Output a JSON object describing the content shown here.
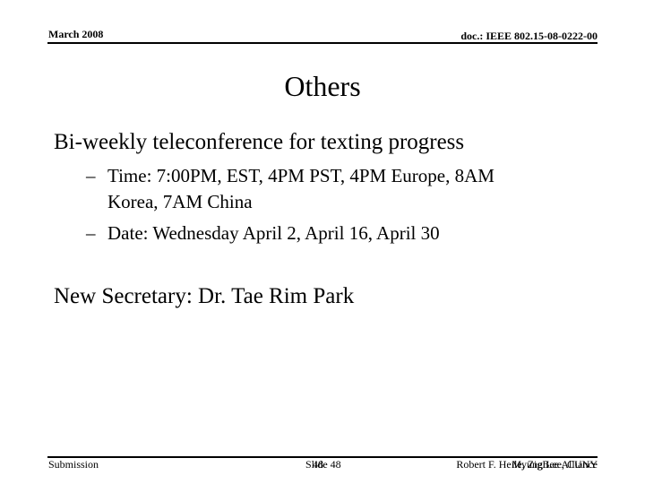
{
  "header": {
    "date": "March 2008",
    "doc_id": "doc.: IEEE 802.15-08-0222-00"
  },
  "slide": {
    "title": "Others",
    "bullets": [
      {
        "text": "Bi-weekly teleconference for texting progress",
        "sub": [
          {
            "dash": "–",
            "line1": "Time: 7:00PM, EST, 4PM PST, 4PM Europe, 8AM",
            "line2": "Korea, 7AM China"
          },
          {
            "dash": "–",
            "line1": "Date: Wednesday April 2,  April 16, April 30"
          }
        ]
      },
      {
        "text": "New Secretary: Dr. Tae Rim Park"
      }
    ]
  },
  "footer": {
    "left": "Submission",
    "center_a": "Slide 48",
    "center_b": "48",
    "right_a": "Robert F. Heile, ZigBee Alliance",
    "right_b": "Myung Lee, CUNY"
  }
}
